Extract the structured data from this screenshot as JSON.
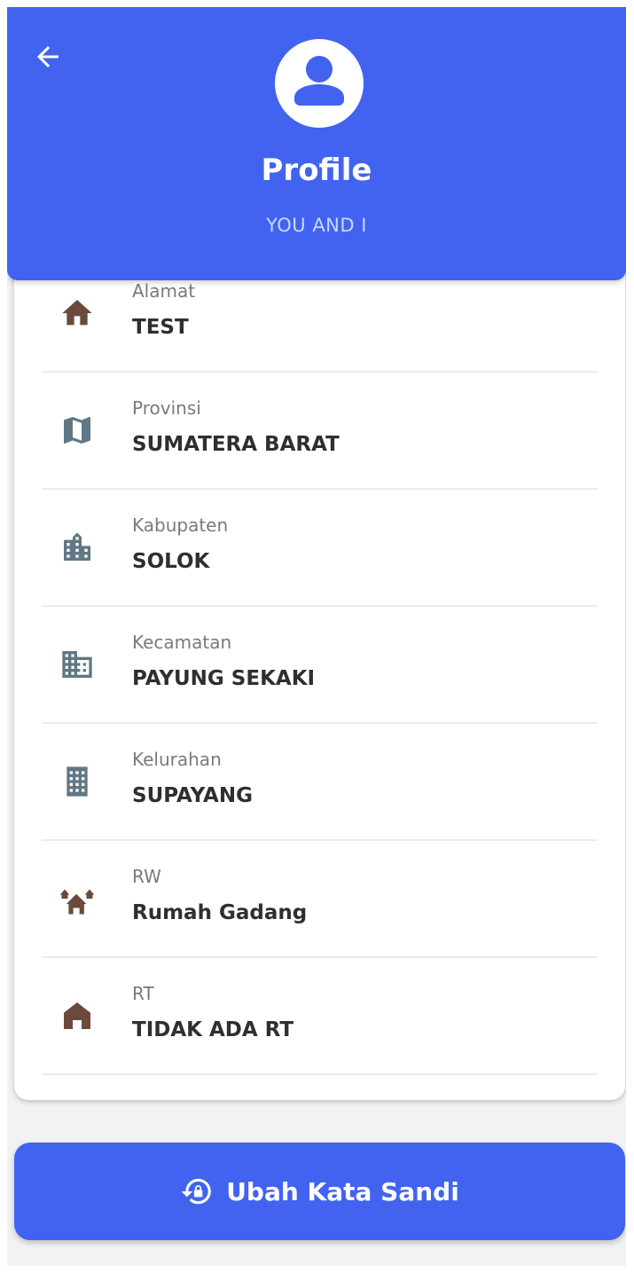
{
  "header": {
    "title": "Profile",
    "subtitle": "YOU AND I",
    "back_icon": "arrow-left-icon",
    "avatar_icon": "account-circle-icon",
    "color": "#4163f0"
  },
  "fields": [
    {
      "label": "Alamat",
      "value": "TEST",
      "icon": "home-icon",
      "icon_color": "#6b4a3c"
    },
    {
      "label": "Provinsi",
      "value": "SUMATERA BARAT",
      "icon": "map-icon",
      "icon_color": "#607884"
    },
    {
      "label": "Kabupaten",
      "value": "SOLOK",
      "icon": "city-icon",
      "icon_color": "#607884"
    },
    {
      "label": "Kecamatan",
      "value": "PAYUNG SEKAKI",
      "icon": "business-icon",
      "icon_color": "#607884"
    },
    {
      "label": "Kelurahan",
      "value": "SUPAYANG",
      "icon": "apartment-icon",
      "icon_color": "#607884"
    },
    {
      "label": "RW",
      "value": "Rumah Gadang",
      "icon": "holiday-village-icon",
      "icon_color": "#6b4a3c"
    },
    {
      "label": "RT",
      "value": "TIDAK ADA RT",
      "icon": "cottage-icon",
      "icon_color": "#6b4a3c"
    }
  ],
  "change_password": {
    "label": "Ubah Kata Sandi",
    "icon": "lock-reset-icon"
  }
}
